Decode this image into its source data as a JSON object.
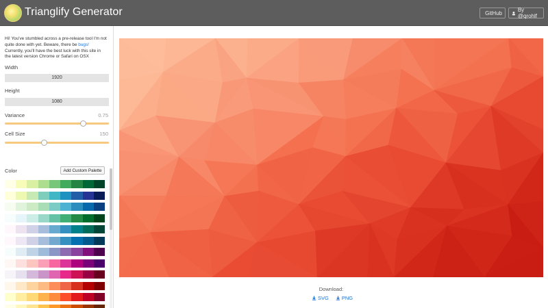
{
  "header": {
    "title": "Trianglify Generator",
    "github_label": "GitHub",
    "author_label": "By @qrohlf"
  },
  "sidebar": {
    "intro_text": "Hi! You've stumbled across a pre-release tool I'm not quite done with yet. Beware, there be ",
    "intro_link": "bugs!",
    "intro_tail": " Currently, you'll have the best luck with this site in the latest version Chrome or Safari on OSX",
    "width_label": "Width",
    "width_value": "1920",
    "height_label": "Height",
    "height_value": "1080",
    "variance_label": "Variance",
    "variance_value": "0.75",
    "variance_level": 0.75,
    "cellsize_label": "Cell Size",
    "cellsize_value": "150",
    "cellsize_level": 0.38,
    "color_label": "Color",
    "add_palette_label": "Add Custom Palette",
    "palettes": [
      [
        "#ffffe5",
        "#f7fcb9",
        "#d9f0a3",
        "#addd8e",
        "#78c679",
        "#41ab5d",
        "#238443",
        "#006837",
        "#004529"
      ],
      [
        "#ffffd9",
        "#edf8b1",
        "#c7e9b4",
        "#7fcdbb",
        "#41b6c4",
        "#1d91c0",
        "#225ea8",
        "#253494",
        "#081d58"
      ],
      [
        "#f7fcf0",
        "#e0f3db",
        "#ccebc5",
        "#a8ddb5",
        "#7bccc4",
        "#4eb3d3",
        "#2b8cbe",
        "#0868ac",
        "#084081"
      ],
      [
        "#f7fcfd",
        "#e5f5f9",
        "#ccece6",
        "#99d8c9",
        "#66c2a4",
        "#41ae76",
        "#238b45",
        "#006d2c",
        "#00441b"
      ],
      [
        "#fff7fb",
        "#ece2f0",
        "#d0d1e6",
        "#a6bddb",
        "#67a9cf",
        "#3690c0",
        "#02818a",
        "#016c59",
        "#014636"
      ],
      [
        "#fff7fb",
        "#ece7f2",
        "#d0d1e6",
        "#a6bddb",
        "#74a9cf",
        "#3690c0",
        "#0570b0",
        "#045a8d",
        "#023858"
      ],
      [
        "#f7fcfd",
        "#e0ecf4",
        "#bfd3e6",
        "#9ebcda",
        "#8c96c6",
        "#8c6bb1",
        "#88419d",
        "#810f7c",
        "#4d004b"
      ],
      [
        "#fff7f3",
        "#fde0dd",
        "#fcc5c0",
        "#fa9fb5",
        "#f768a1",
        "#dd3497",
        "#ae017e",
        "#7a0177",
        "#49006a"
      ],
      [
        "#f7f4f9",
        "#e7e1ef",
        "#d4b9da",
        "#c994c7",
        "#df65b0",
        "#e7298a",
        "#ce1256",
        "#980043",
        "#67001f"
      ],
      [
        "#fff7ec",
        "#fee8c8",
        "#fdd49e",
        "#fdbb84",
        "#fc8d59",
        "#ef6548",
        "#d7301f",
        "#b30000",
        "#7f0000"
      ],
      [
        "#ffffcc",
        "#ffeda0",
        "#fed976",
        "#feb24c",
        "#fd8d3c",
        "#fc4e2a",
        "#e31a1c",
        "#bd0026",
        "#800026"
      ],
      [
        "#ffffe5",
        "#fff7bc",
        "#fee391",
        "#fec44f",
        "#fe9929",
        "#ec7014",
        "#cc4c02",
        "#993404",
        "#662506"
      ]
    ]
  },
  "canvas": {
    "palette": [
      "#ffc8a8",
      "#fcb08d",
      "#f89070",
      "#f4714f",
      "#ea4e35",
      "#d93220",
      "#c91c12"
    ]
  },
  "download": {
    "label": "Download:",
    "svg_label": "SVG",
    "png_label": "PNG"
  }
}
